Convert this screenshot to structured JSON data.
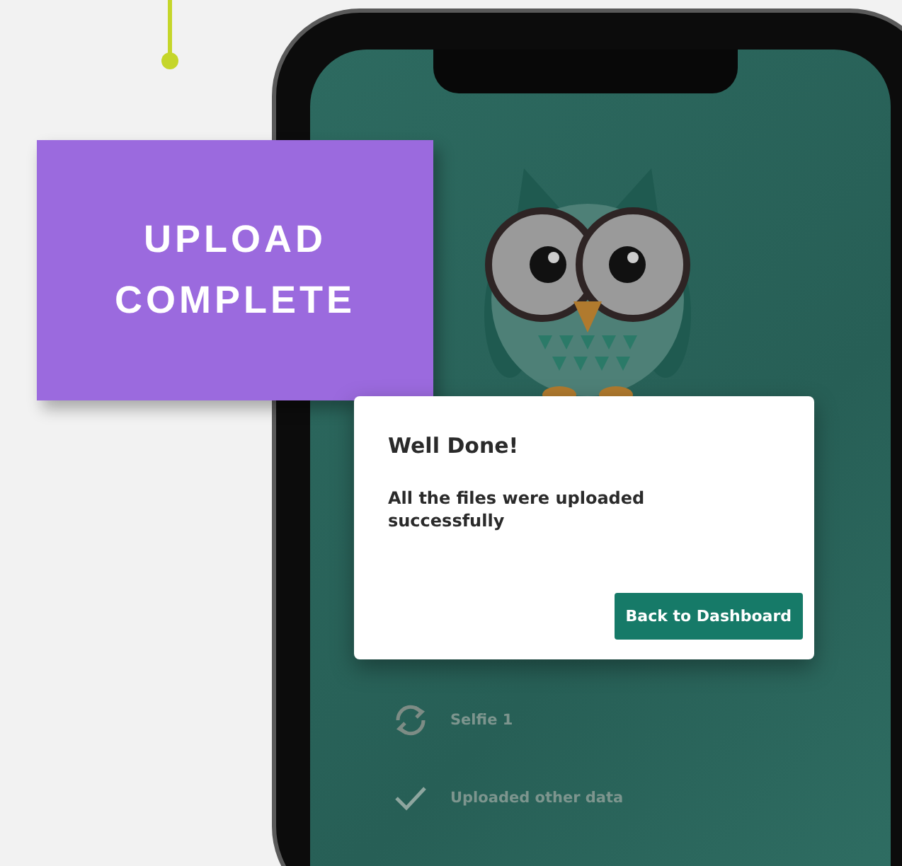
{
  "callout": {
    "title": "UPLOAD COMPLETE"
  },
  "dialog": {
    "title": "Well Done!",
    "message": "All the files were uploaded successfully",
    "button": "Back to Dashboard"
  },
  "uploads": [
    {
      "kind": "syncing",
      "label": "Selfie 1"
    },
    {
      "kind": "done",
      "label": "Uploaded other data"
    }
  ]
}
